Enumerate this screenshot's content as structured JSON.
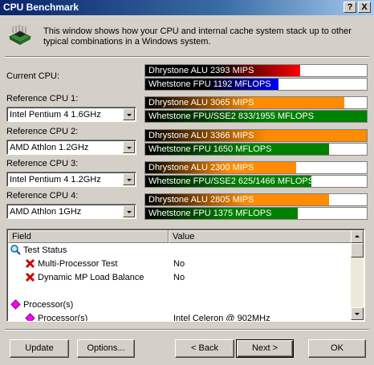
{
  "window": {
    "title": "CPU Benchmark",
    "help_btn": "?",
    "close_btn": "X"
  },
  "intro": {
    "icon": "chip-icon",
    "text": "This window shows how your CPU and internal cache system stack up to other typical combinations in a Windows system."
  },
  "current_cpu": {
    "label": "Current CPU:",
    "alu": {
      "text": "Dhrystone ALU 2393 MIPS",
      "fraction": 0.7,
      "color": "#ff0000"
    },
    "fpu": {
      "text": "Whetstone FPU 1192 MFLOPS",
      "fraction": 0.6,
      "color": "#0000ff"
    }
  },
  "references": [
    {
      "label": "Reference CPU 1:",
      "selected": "Intel Pentium 4 1.6GHz",
      "alu": {
        "text": "Dhrystone ALU 3065 MIPS",
        "fraction": 0.9
      },
      "fpu": {
        "text": "Whetstone FPU/SSE2 833/1955 MFLOPS",
        "fraction": 1.0
      }
    },
    {
      "label": "Reference CPU 2:",
      "selected": "AMD Athlon 1.2GHz",
      "alu": {
        "text": "Dhrystone ALU 3366 MIPS",
        "fraction": 1.0
      },
      "fpu": {
        "text": "Whetstone FPU 1650 MFLOPS",
        "fraction": 0.83
      }
    },
    {
      "label": "Reference CPU 3:",
      "selected": "Intel Pentium 4 1.2GHz",
      "alu": {
        "text": "Dhrystone ALU 2300 MIPS",
        "fraction": 0.68
      },
      "fpu": {
        "text": "Whetstone FPU/SSE2 625/1466 MFLOPS",
        "fraction": 0.75
      }
    },
    {
      "label": "Reference CPU 4:",
      "selected": "AMD Athlon 1GHz",
      "alu": {
        "text": "Dhrystone ALU 2805 MIPS",
        "fraction": 0.83
      },
      "fpu": {
        "text": "Whetstone FPU 1375 MFLOPS",
        "fraction": 0.69
      }
    }
  ],
  "colors": {
    "alu": "#ff8c00",
    "fpu": "#008000"
  },
  "list": {
    "columns": [
      "Field",
      "Value"
    ],
    "rows": [
      {
        "icon": "magnifier-icon",
        "field": "Test Status",
        "value": "",
        "indent": 0
      },
      {
        "icon": "red-x-icon",
        "field": "Multi-Processor Test",
        "value": "No",
        "indent": 1
      },
      {
        "icon": "red-x-icon",
        "field": "Dynamic MP Load Balance",
        "value": "No",
        "indent": 1
      },
      {
        "icon": "",
        "field": "",
        "value": "",
        "indent": 0
      },
      {
        "icon": "magenta-diamond-icon",
        "field": "Processor(s)",
        "value": "",
        "indent": 0
      },
      {
        "icon": "magenta-diamond-icon",
        "field": "Processor(s)",
        "value": "Intel Celeron @ 902MHz",
        "indent": 1
      }
    ]
  },
  "buttons": {
    "update": "Update",
    "options": "Options...",
    "back": "< Back",
    "next": "Next >",
    "ok": "OK"
  }
}
